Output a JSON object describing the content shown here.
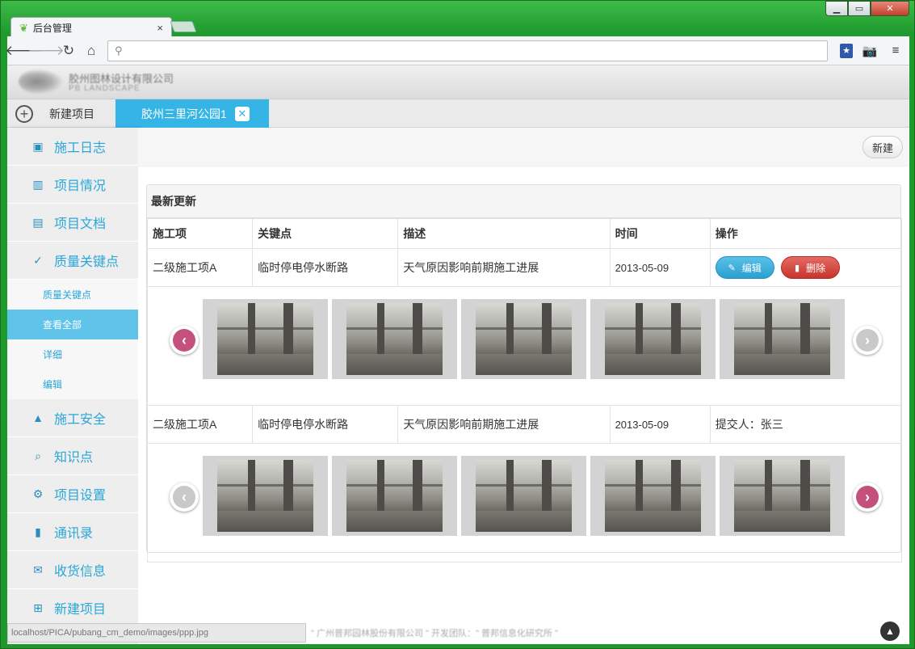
{
  "browser": {
    "tab_title": "后台管理",
    "tab_close": "×",
    "omnibox_placeholder": ""
  },
  "header": {
    "company_name": "胶州图林设计有限公司",
    "company_sub": "PB LANDSCAPE"
  },
  "project_tabs": {
    "new_project": "新建项目",
    "active_project": "胶州三里河公园1",
    "close_glyph": "✕"
  },
  "sidebar": {
    "items": [
      {
        "label": "施工日志",
        "icon": "log-icon"
      },
      {
        "label": "项目情况",
        "icon": "bar-chart-icon"
      },
      {
        "label": "项目文档",
        "icon": "document-icon"
      },
      {
        "label": "质量关键点",
        "icon": "check-icon"
      }
    ],
    "sub_items": [
      {
        "label": "质量关键点"
      },
      {
        "label": "查看全部",
        "active": true
      },
      {
        "label": "详细"
      },
      {
        "label": "编辑"
      }
    ],
    "items_after": [
      {
        "label": "施工安全",
        "icon": "warning-icon"
      },
      {
        "label": "知识点",
        "icon": "search-doc-icon"
      },
      {
        "label": "项目设置",
        "icon": "gear-icon"
      },
      {
        "label": "通讯录",
        "icon": "address-book-icon"
      },
      {
        "label": "收货信息",
        "icon": "mail-icon"
      },
      {
        "label": "新建项目",
        "icon": "plus-square-icon"
      }
    ]
  },
  "main": {
    "new_button": "新建",
    "panel_title": "最新更新",
    "columns": [
      "施工项",
      "关键点",
      "描述",
      "时间",
      "操作"
    ],
    "rows": [
      {
        "item": "二级施工项A",
        "key_point": "临时停电停水断路",
        "description": "天气原因影响前期施工进展",
        "date": "2013-05-09",
        "edit": "编辑",
        "delete": "删除"
      },
      {
        "item": "二级施工项A",
        "key_point": "临时停电停水断路",
        "description": "天气原因影响前期施工进展",
        "date": "2013-05-09",
        "submitter": "提交人：张三"
      }
    ]
  },
  "footer": {
    "status_url": "localhost/PICA/pubang_cm_demo/images/ppp.jpg",
    "copyright": "\" 广州普邦园林股份有限公司 \"       开发团队：\" 普邦信息化研究所 \""
  },
  "colors": {
    "accent": "#35b4e6",
    "sidebar_text": "#2aa6d9",
    "edit": "#2b9fd0",
    "delete": "#c8352c",
    "arrow_active": "#c4507c"
  }
}
